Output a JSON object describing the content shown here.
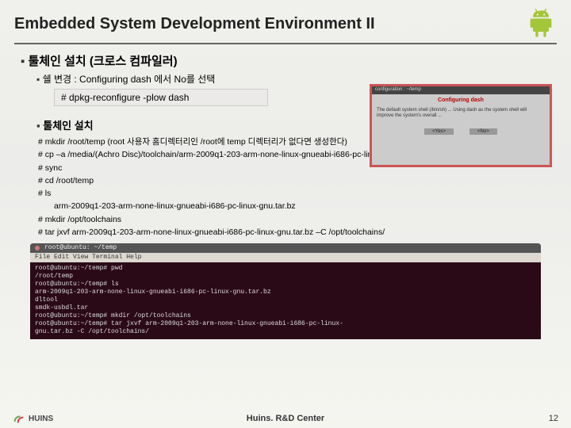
{
  "title": "Embedded System Development Environment II",
  "sections": {
    "s1": {
      "heading": "툴체인 설치 (크로스 컴파일러)",
      "sub1": "쉘 변경 : Configuring dash 에서 No를 선택",
      "cmd1": "# dpkg-reconfigure -plow dash"
    },
    "s2": {
      "heading": "툴체인 설치",
      "lines": [
        "# mkdir /root/temp (root 사용자 홈디렉터리인 /root에 temp 디렉터리가 없다면 생성한다)",
        "# cp –a /media/(Achro Disc)/toolchain/arm-2009q1-203-arm-none-linux-gnueabi-i686-pc-linux-gnu.tar.bz /root/temp/",
        "# sync",
        "# cd /root/temp",
        "# ls",
        "arm-2009q1-203-arm-none-linux-gnueabi-i686-pc-linux-gnu.tar.bz",
        "# mkdir /opt/toolchains",
        "# tar jxvf arm-2009q1-203-arm-none-linux-gnueabi-i686-pc-linux-gnu.tar.bz –C /opt/toolchains/"
      ]
    }
  },
  "dialog": {
    "titlebar": "configuration : ~/temp",
    "red": "Configuring dash",
    "body": "The default system shell (/bin/sh) ... Using dash as the system shell will improve the system's overall ...",
    "yes": "<Yes>",
    "no": "<No>"
  },
  "terminal": {
    "title": "root@ubuntu: ~/temp",
    "menu": "File  Edit  View  Terminal  Help",
    "lines": [
      "root@ubuntu:~/temp# pwd",
      "/root/temp",
      "root@ubuntu:~/temp# ls",
      "arm-2009q1-203-arm-none-linux-gnueabi-i686-pc-linux-gnu.tar.bz",
      "dltool",
      "smdk-usbdl.tar",
      "root@ubuntu:~/temp# mkdir /opt/toolchains",
      "root@ubuntu:~/temp# tar jxvf arm-2009q1-203-arm-none-linux-gnueabi-i686-pc-linux-",
      "gnu.tar.bz -C /opt/toolchains/"
    ]
  },
  "footer": {
    "center": "Huins. R&D Center",
    "logo": "HUINS",
    "page": "12"
  }
}
